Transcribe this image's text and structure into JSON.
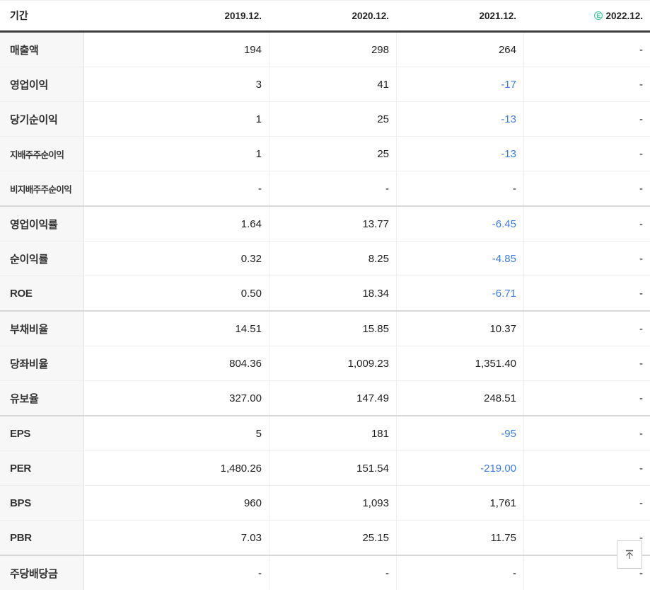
{
  "table": {
    "header": {
      "period_label": "기간",
      "estimate_badge": "E",
      "columns": [
        {
          "label": "2019.12.",
          "estimate": false
        },
        {
          "label": "2020.12.",
          "estimate": false
        },
        {
          "label": "2021.12.",
          "estimate": false
        },
        {
          "label": "2022.12.",
          "estimate": true
        }
      ]
    },
    "rows": [
      {
        "label": "매출액",
        "group_start": false,
        "values": [
          "194",
          "298",
          "264",
          "-"
        ]
      },
      {
        "label": "영업이익",
        "group_start": false,
        "values": [
          "3",
          "41",
          "-17",
          "-"
        ]
      },
      {
        "label": "당기순이익",
        "group_start": false,
        "values": [
          "1",
          "25",
          "-13",
          "-"
        ]
      },
      {
        "label": "지배주주순이익",
        "group_start": false,
        "values": [
          "1",
          "25",
          "-13",
          "-"
        ]
      },
      {
        "label": "비지배주주순이익",
        "group_start": false,
        "values": [
          "-",
          "-",
          "-",
          "-"
        ]
      },
      {
        "label": "영업이익률",
        "group_start": true,
        "values": [
          "1.64",
          "13.77",
          "-6.45",
          "-"
        ]
      },
      {
        "label": "순이익률",
        "group_start": false,
        "values": [
          "0.32",
          "8.25",
          "-4.85",
          "-"
        ]
      },
      {
        "label": "ROE",
        "group_start": false,
        "values": [
          "0.50",
          "18.34",
          "-6.71",
          "-"
        ]
      },
      {
        "label": "부채비율",
        "group_start": true,
        "values": [
          "14.51",
          "15.85",
          "10.37",
          "-"
        ]
      },
      {
        "label": "당좌비율",
        "group_start": false,
        "values": [
          "804.36",
          "1,009.23",
          "1,351.40",
          "-"
        ]
      },
      {
        "label": "유보율",
        "group_start": false,
        "values": [
          "327.00",
          "147.49",
          "248.51",
          "-"
        ]
      },
      {
        "label": "EPS",
        "group_start": true,
        "values": [
          "5",
          "181",
          "-95",
          "-"
        ]
      },
      {
        "label": "PER",
        "group_start": false,
        "values": [
          "1,480.26",
          "151.54",
          "-219.00",
          "-"
        ]
      },
      {
        "label": "BPS",
        "group_start": false,
        "values": [
          "960",
          "1,093",
          "1,761",
          "-"
        ]
      },
      {
        "label": "PBR",
        "group_start": false,
        "values": [
          "7.03",
          "25.15",
          "11.75",
          "-"
        ]
      },
      {
        "label": "주당배당금",
        "group_start": true,
        "values": [
          "-",
          "-",
          "-",
          "-"
        ]
      }
    ]
  },
  "colors": {
    "negative_value": "#3c7de9",
    "estimate_green": "#3bc99c",
    "header_rule": "#3c3c3c",
    "label_column_bg": "#f7f7f7"
  },
  "floating": {
    "scroll_top_icon": "arrow-up-to-top"
  }
}
